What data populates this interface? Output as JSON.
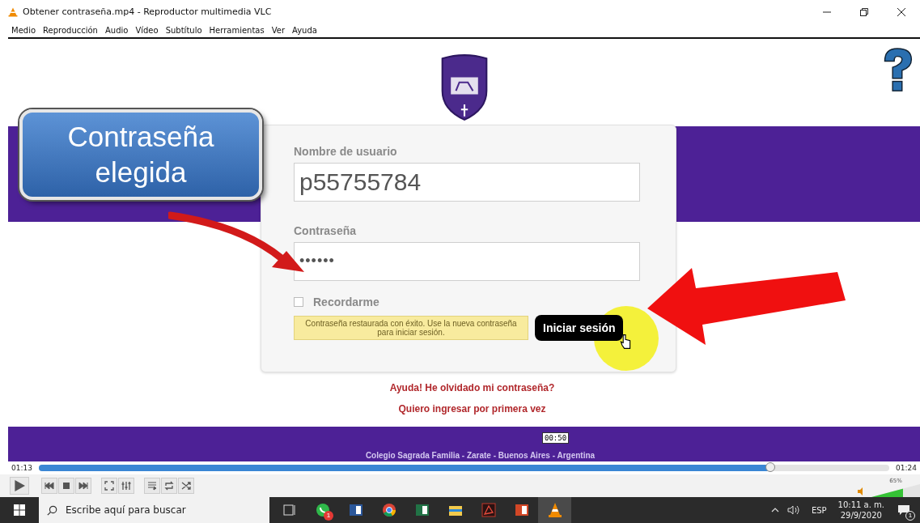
{
  "window": {
    "title": "Obtener contraseña.mp4 - Reproductor multimedia VLC"
  },
  "menu": [
    "Medio",
    "Reproducción",
    "Audio",
    "Vídeo",
    "Subtítulo",
    "Herramientas",
    "Ver",
    "Ayuda"
  ],
  "video": {
    "callout": "Contraseña elegida",
    "login": {
      "username_label": "Nombre de usuario",
      "username_value": "p55755784",
      "password_label": "Contraseña",
      "password_value": "••••••",
      "remember": {
        "label": "Recordarme",
        "checked": false
      },
      "message": "Contraseña restaurada con éxito. Use la nueva contraseña para iniciar sesión.",
      "submit": "Iniciar sesión"
    },
    "links": [
      "Ayuda! He olvidado mi contraseña?",
      "Quiero ingresar por primera vez"
    ],
    "footer": "Colegio Sagrada Familia - Zarate - Buenos Aires - Argentina"
  },
  "seek_tooltip": "00:50",
  "player": {
    "elapsed": "01:13",
    "total": "01:24",
    "seek": {
      "level": 0.86
    },
    "volume": {
      "level": 0.65,
      "reading": "65%"
    }
  },
  "taskbar": {
    "search_placeholder": "Escribe aquí para buscar",
    "apps": [
      {
        "kind": "taskview",
        "selected": false
      },
      {
        "kind": "whatsapp",
        "selected": false,
        "badge": "1"
      },
      {
        "kind": "word",
        "selected": false
      },
      {
        "kind": "chrome",
        "selected": false
      },
      {
        "kind": "excel",
        "selected": false
      },
      {
        "kind": "explorer",
        "selected": false
      },
      {
        "kind": "acrobat",
        "selected": false
      },
      {
        "kind": "powerpoint",
        "selected": false
      },
      {
        "kind": "vlc",
        "selected": true
      }
    ],
    "language": "ESP",
    "time": "10:11 a. m.",
    "date": "29/9/2020",
    "notifications": "1"
  }
}
